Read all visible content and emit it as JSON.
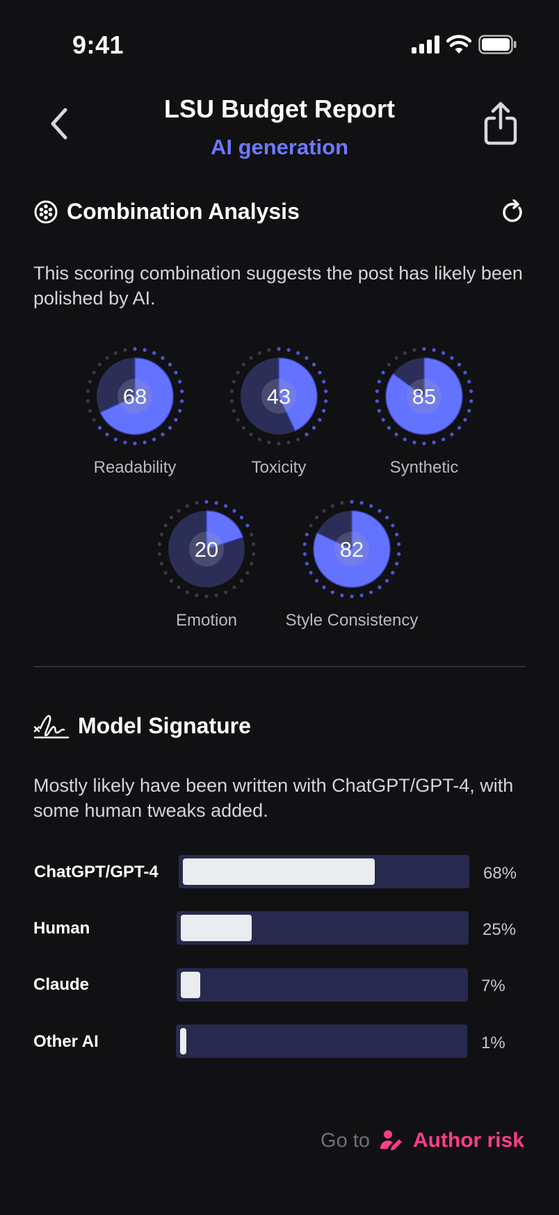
{
  "status_bar": {
    "time": "9:41"
  },
  "header": {
    "title": "LSU Budget Report",
    "subtitle": "AI generation"
  },
  "combination": {
    "title": "Combination Analysis",
    "description": "This scoring combination suggests the post has likely been polished by AI.",
    "gauges": [
      {
        "label": "Readability",
        "value": 68
      },
      {
        "label": "Toxicity",
        "value": 43
      },
      {
        "label": "Synthetic",
        "value": 85
      },
      {
        "label": "Emotion",
        "value": 20
      },
      {
        "label": "Style Consistency",
        "value": 82
      }
    ]
  },
  "signature": {
    "title": "Model Signature",
    "description": "Mostly likely have been written with ChatGPT/GPT-4, with some human tweaks added.",
    "bars": [
      {
        "label": "ChatGPT/GPT-4",
        "value": 68,
        "pct": "68%"
      },
      {
        "label": "Human",
        "value": 25,
        "pct": "25%"
      },
      {
        "label": "Claude",
        "value": 7,
        "pct": "7%"
      },
      {
        "label": "Other AI",
        "value": 1,
        "pct": "1%"
      }
    ]
  },
  "footer": {
    "goto": "Go to",
    "link": "Author risk"
  },
  "colors": {
    "accent": "#6c79ff",
    "gauge_fill": "#6473ff",
    "gauge_bg": "#2b2e57",
    "bar_track": "#272a4e",
    "bar_fill": "#ebecef",
    "link": "#ff3d8b"
  }
}
